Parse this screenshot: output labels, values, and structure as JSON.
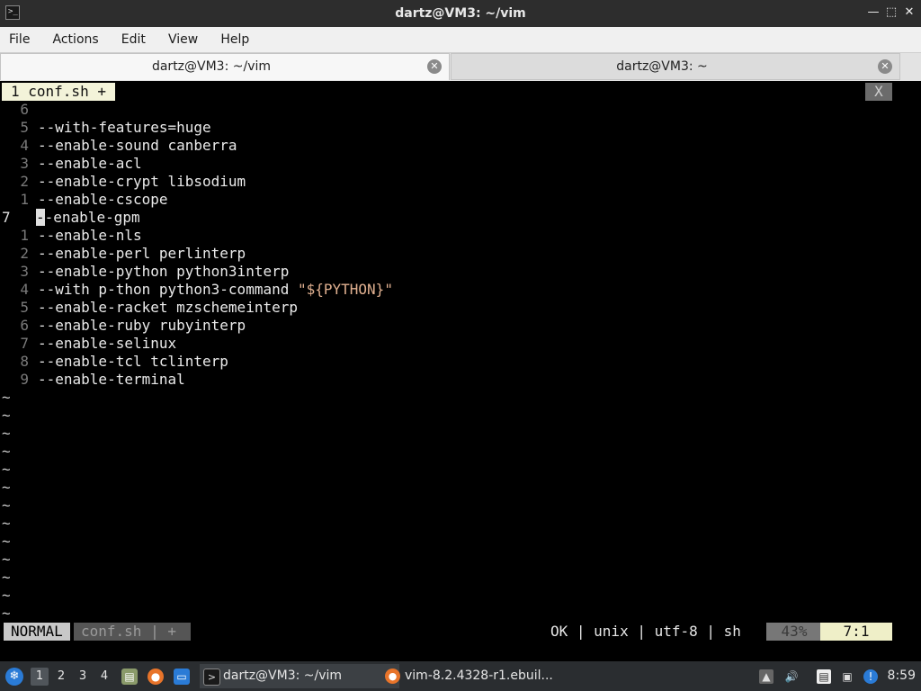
{
  "window": {
    "title": "dartz@VM3: ~/vim",
    "app_icon": "terminal-icon",
    "controls": [
      "minimize-icon",
      "maximize-icon",
      "close-icon"
    ]
  },
  "menu": [
    "File",
    "Actions",
    "Edit",
    "View",
    "Help"
  ],
  "tabs": [
    {
      "label": "dartz@VM3: ~/vim",
      "active": true
    },
    {
      "label": "dartz@VM3: ~",
      "active": false
    }
  ],
  "vim": {
    "tabline": {
      "buffer": "1 conf.sh +",
      "close": "X"
    },
    "lines": [
      {
        "num": "6",
        "text": ""
      },
      {
        "num": "5",
        "text": "--with-features=huge"
      },
      {
        "num": "4",
        "text": "--enable-sound canberra"
      },
      {
        "num": "3",
        "text": "--enable-acl"
      },
      {
        "num": "2",
        "text": "--enable-crypt libsodium"
      },
      {
        "num": "1",
        "text": "--enable-cscope"
      },
      {
        "num": "7",
        "text": "--enable-gpm",
        "current": true
      },
      {
        "num": "1",
        "text": "--enable-nls"
      },
      {
        "num": "2",
        "text": "--enable-perl perlinterp"
      },
      {
        "num": "3",
        "text": "--enable-python python3interp"
      },
      {
        "num": "4",
        "text": "--with p-thon python3-command ",
        "string": "\"${PYTHON}\""
      },
      {
        "num": "5",
        "text": "--enable-racket mzschemeinterp"
      },
      {
        "num": "6",
        "text": "--enable-ruby rubyinterp"
      },
      {
        "num": "7",
        "text": "--enable-selinux"
      },
      {
        "num": "8",
        "text": "--enable-tcl tclinterp"
      },
      {
        "num": "9",
        "text": "--enable-terminal"
      }
    ],
    "tilde_count": 13,
    "tilde": "~",
    "statusline": {
      "mode": "NORMAL",
      "file": "conf.sh | +",
      "info": "OK | unix | utf-8 | sh",
      "percent": "43%",
      "position": "7:1"
    }
  },
  "taskbar": {
    "workspaces": [
      "1",
      "2",
      "3",
      "4"
    ],
    "active_workspace": "1",
    "quicklaunch": [
      "file-manager-icon",
      "firefox-icon",
      "desktop-icon"
    ],
    "tasks": [
      {
        "label": "dartz@VM3: ~/vim",
        "icon": "terminal-icon",
        "active": true
      },
      {
        "label": "vim-8.2.4328-r1.ebuil...",
        "icon": "firefox-icon",
        "active": false
      }
    ],
    "tray": [
      "eject-icon",
      "volume-icon",
      "clipboard-icon",
      "network-icon",
      "notification-icon"
    ],
    "clock": "8:59"
  }
}
